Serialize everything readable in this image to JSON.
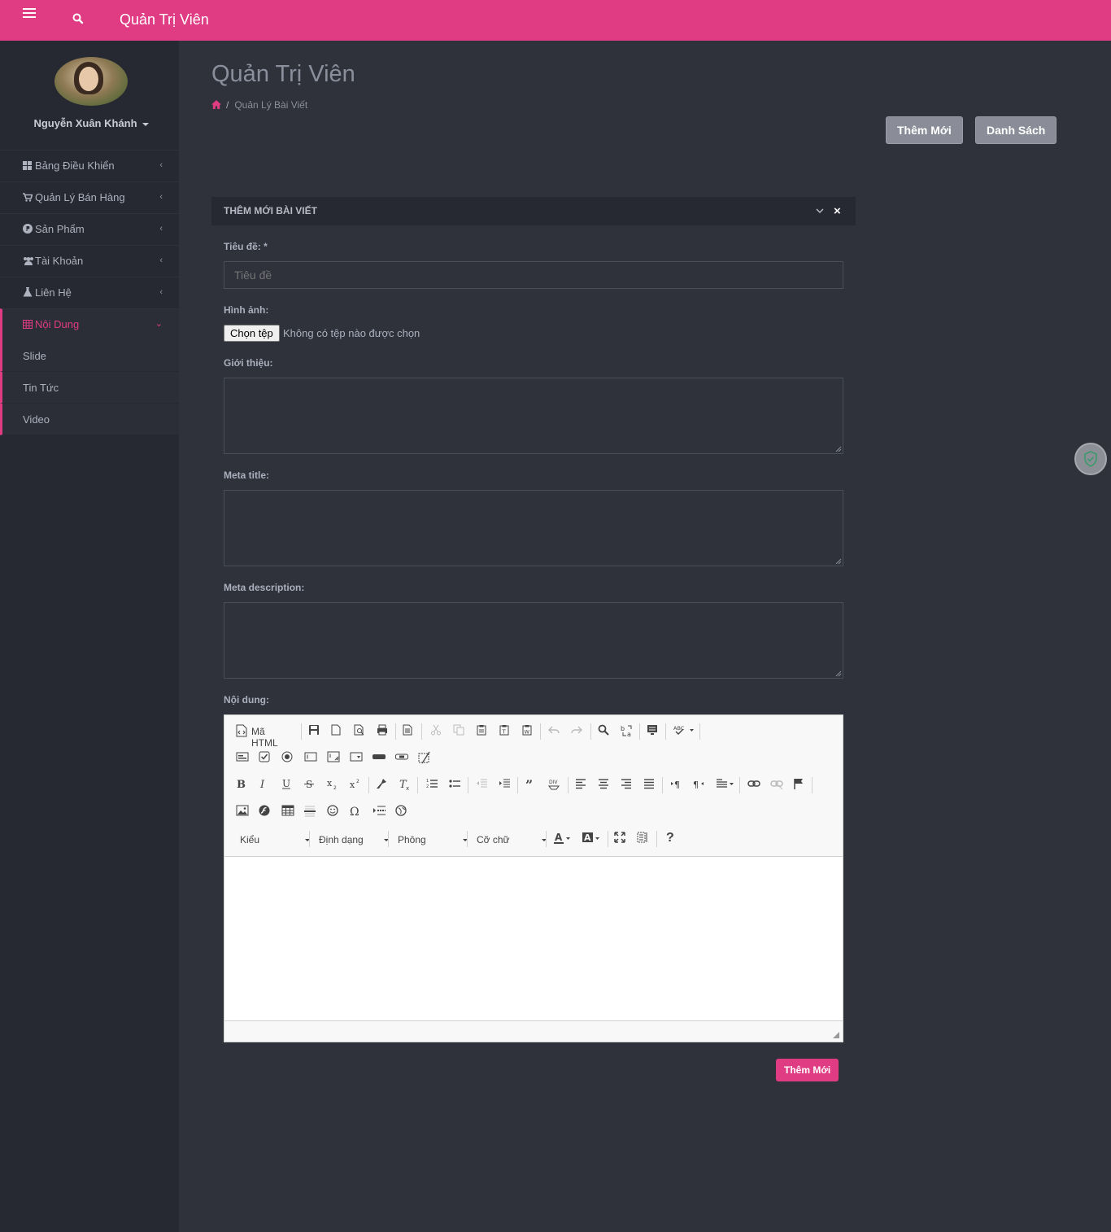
{
  "topbar": {
    "title": "Quản Trị Viên"
  },
  "user": {
    "name": "Nguyễn Xuân Khánh"
  },
  "nav": {
    "items": [
      {
        "label": "Bảng Điều Khiển"
      },
      {
        "label": "Quản Lý Bán Hàng"
      },
      {
        "label": "Sản Phẩm"
      },
      {
        "label": "Tài Khoản"
      },
      {
        "label": "Liên Hệ"
      },
      {
        "label": "Nội Dung"
      }
    ],
    "sub": [
      {
        "label": "Slide"
      },
      {
        "label": "Tin Tức"
      },
      {
        "label": "Video"
      }
    ]
  },
  "page": {
    "title": "Quản Trị Viên",
    "breadcrumb": {
      "sep": "/",
      "current": "Quản Lý Bài Viết"
    },
    "btn_add": "Thêm Mới",
    "btn_list": "Danh Sách"
  },
  "panel": {
    "title": "THÊM MỚI BÀI VIẾT",
    "close": "×"
  },
  "form": {
    "title_label": "Tiêu đề: *",
    "title_placeholder": "Tiêu đề",
    "image_label": "Hình ảnh:",
    "file_button": "Chọn tệp",
    "file_status": "Không có tệp nào được chọn",
    "intro_label": "Giới thiệu:",
    "meta_title_label": "Meta title:",
    "meta_desc_label": "Meta description:",
    "content_label": "Nội dung:",
    "submit": "Thêm Mới"
  },
  "editor": {
    "source_label": "Mã HTML",
    "style_combo": "Kiểu",
    "format_combo": "Định dạng",
    "font_combo": "Phông",
    "size_combo": "Cỡ chữ",
    "help": "?"
  },
  "colors": {
    "accent": "#e03c83",
    "sidebar": "#262832",
    "background": "#2f313b"
  }
}
